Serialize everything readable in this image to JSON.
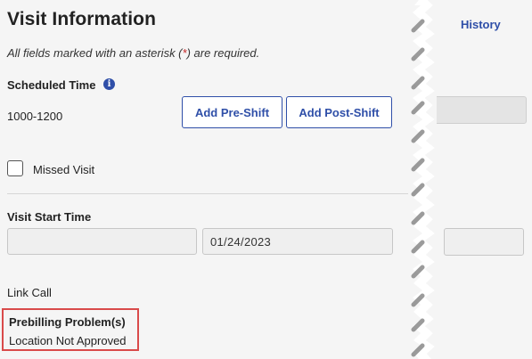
{
  "visit": {
    "title": "Visit Information",
    "required_note_prefix": "All fields marked with an asterisk (",
    "required_note_asterisk": "*",
    "required_note_suffix": ") are required."
  },
  "scheduled_time": {
    "label": "Scheduled Time",
    "info_icon": "info-icon",
    "value": "1000-1200"
  },
  "buttons": {
    "add_pre_shift": "Add Pre-Shift",
    "add_post_shift": "Add Post-Shift"
  },
  "missed_visit": {
    "label": "Missed Visit",
    "checked": false
  },
  "visit_start_time": {
    "label": "Visit Start Time",
    "time_value": "",
    "date_value": "01/24/2023"
  },
  "link_call": {
    "label": "Link Call"
  },
  "prebilling": {
    "title": "Prebilling Problem(s)",
    "value": "Location Not Approved"
  },
  "right_panel": {
    "history_tab": "History"
  },
  "colors": {
    "accent": "#2f4fa8",
    "required": "#c62828",
    "highlight_border": "#d94a4a",
    "background": "#f5f5f5"
  }
}
